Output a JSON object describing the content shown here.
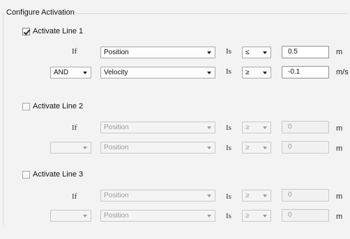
{
  "group": {
    "title": "Configure Activation"
  },
  "lines": [
    {
      "label": "Activate Line 1",
      "checked": true,
      "rows": [
        {
          "prefix_text": "If",
          "prefix_select": null,
          "variable": "Position",
          "is_label": "Is",
          "operator": "≤",
          "value": "0.5",
          "unit": "m"
        },
        {
          "prefix_text": null,
          "prefix_select": "AND",
          "variable": "Velocity",
          "is_label": "Is",
          "operator": "≥",
          "value": "-0.1",
          "unit": "m/s"
        }
      ]
    },
    {
      "label": "Activate Line 2",
      "checked": false,
      "rows": [
        {
          "prefix_text": "If",
          "prefix_select": null,
          "variable": "Position",
          "is_label": "Is",
          "operator": "≥",
          "value": "0",
          "unit": "m"
        },
        {
          "prefix_text": null,
          "prefix_select": "",
          "variable": "Position",
          "is_label": "Is",
          "operator": "≥",
          "value": "0",
          "unit": "m"
        }
      ]
    },
    {
      "label": "Activate Line 3",
      "checked": false,
      "rows": [
        {
          "prefix_text": "If",
          "prefix_select": null,
          "variable": "Position",
          "is_label": "Is",
          "operator": "≥",
          "value": "0",
          "unit": "m"
        },
        {
          "prefix_text": null,
          "prefix_select": "",
          "variable": "Position",
          "is_label": "Is",
          "operator": "≥",
          "value": "0",
          "unit": "m"
        }
      ]
    }
  ]
}
